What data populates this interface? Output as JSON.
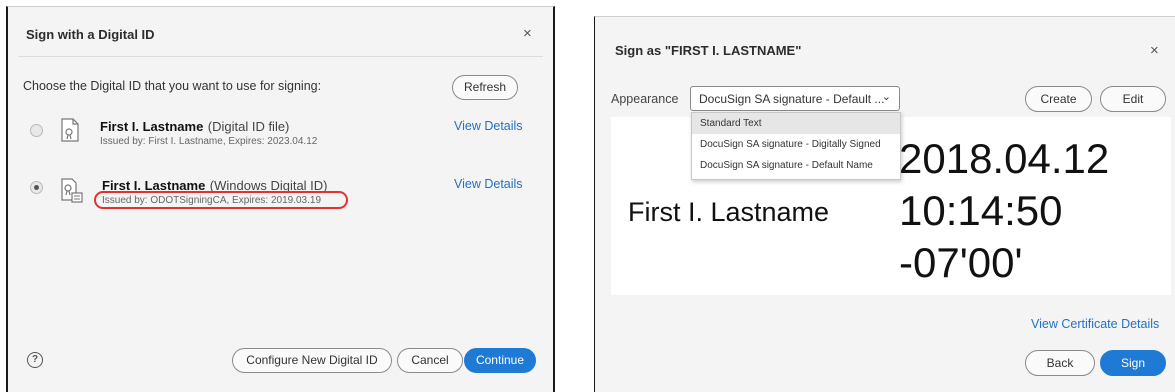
{
  "left_dialog": {
    "title": "Sign with a Digital ID",
    "close_icon": "×",
    "prompt": "Choose the Digital ID that you want to use for signing:",
    "refresh_label": "Refresh",
    "ids": [
      {
        "name": "First I. Lastname",
        "type": "(Digital ID file)",
        "issued": "Issued by: First I. Lastname, Expires: 2023.04.12",
        "view_details": "View Details",
        "selected": false,
        "icon": "certificate-file-icon"
      },
      {
        "name": "First I. Lastname",
        "type": "(Windows Digital ID)",
        "issued": "Issued by: ODOTSigningCA, Expires: 2019.03.19",
        "view_details": "View Details",
        "selected": true,
        "icon": "windows-certificate-icon"
      }
    ],
    "help_icon": "?",
    "configure_label": "Configure New Digital ID",
    "cancel_label": "Cancel",
    "continue_label": "Continue",
    "highlight_color": "#e53030",
    "accent_color": "#1f7ad6"
  },
  "right_dialog": {
    "title": "Sign as \"FIRST I. LASTNAME\"",
    "close_icon": "×",
    "appearance_label": "Appearance",
    "appearance_value": "DocuSign SA signature - Default ...",
    "create_label": "Create",
    "edit_label": "Edit",
    "dropdown_options": [
      "Standard Text",
      "DocuSign SA signature - Digitally Signed",
      "DocuSign SA signature - Default Name"
    ],
    "preview": {
      "name": "First I. Lastname",
      "date": "2018.04.12",
      "time": "10:14:50",
      "tz": "-07'00'"
    },
    "view_cert_label": "View Certificate Details",
    "back_label": "Back",
    "sign_label": "Sign"
  }
}
